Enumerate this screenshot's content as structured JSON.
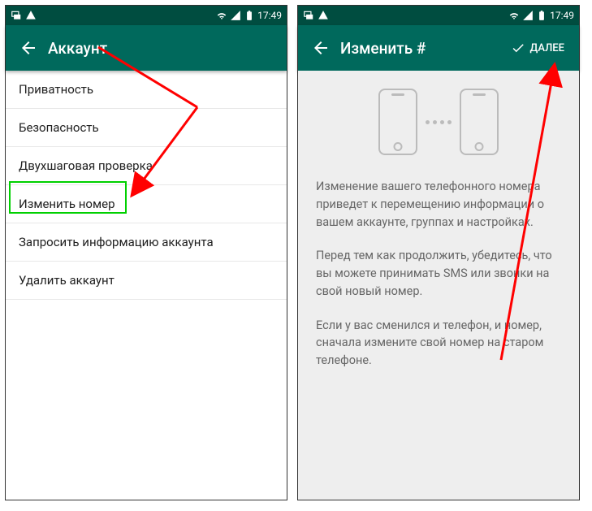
{
  "statusbar": {
    "time": "17:49"
  },
  "screen1": {
    "title": "Аккаунт",
    "items": [
      "Приватность",
      "Безопасность",
      "Двухшаговая проверка",
      "Изменить номер",
      "Запросить информацию аккаунта",
      "Удалить аккаунт"
    ]
  },
  "screen2": {
    "title": "Изменить #",
    "next": "ДАЛЕЕ",
    "para1": "Изменение вашего телефонного номера приведет к перемещению информации о вашем аккаунте, группах и настройках.",
    "para2": "Перед тем как продолжить, убедитесь, что вы можете принимать SMS или звонки на свой новый номер.",
    "para3": "Если у вас сменился и телефон, и номер, сначала измените свой номер на старом телефоне."
  }
}
